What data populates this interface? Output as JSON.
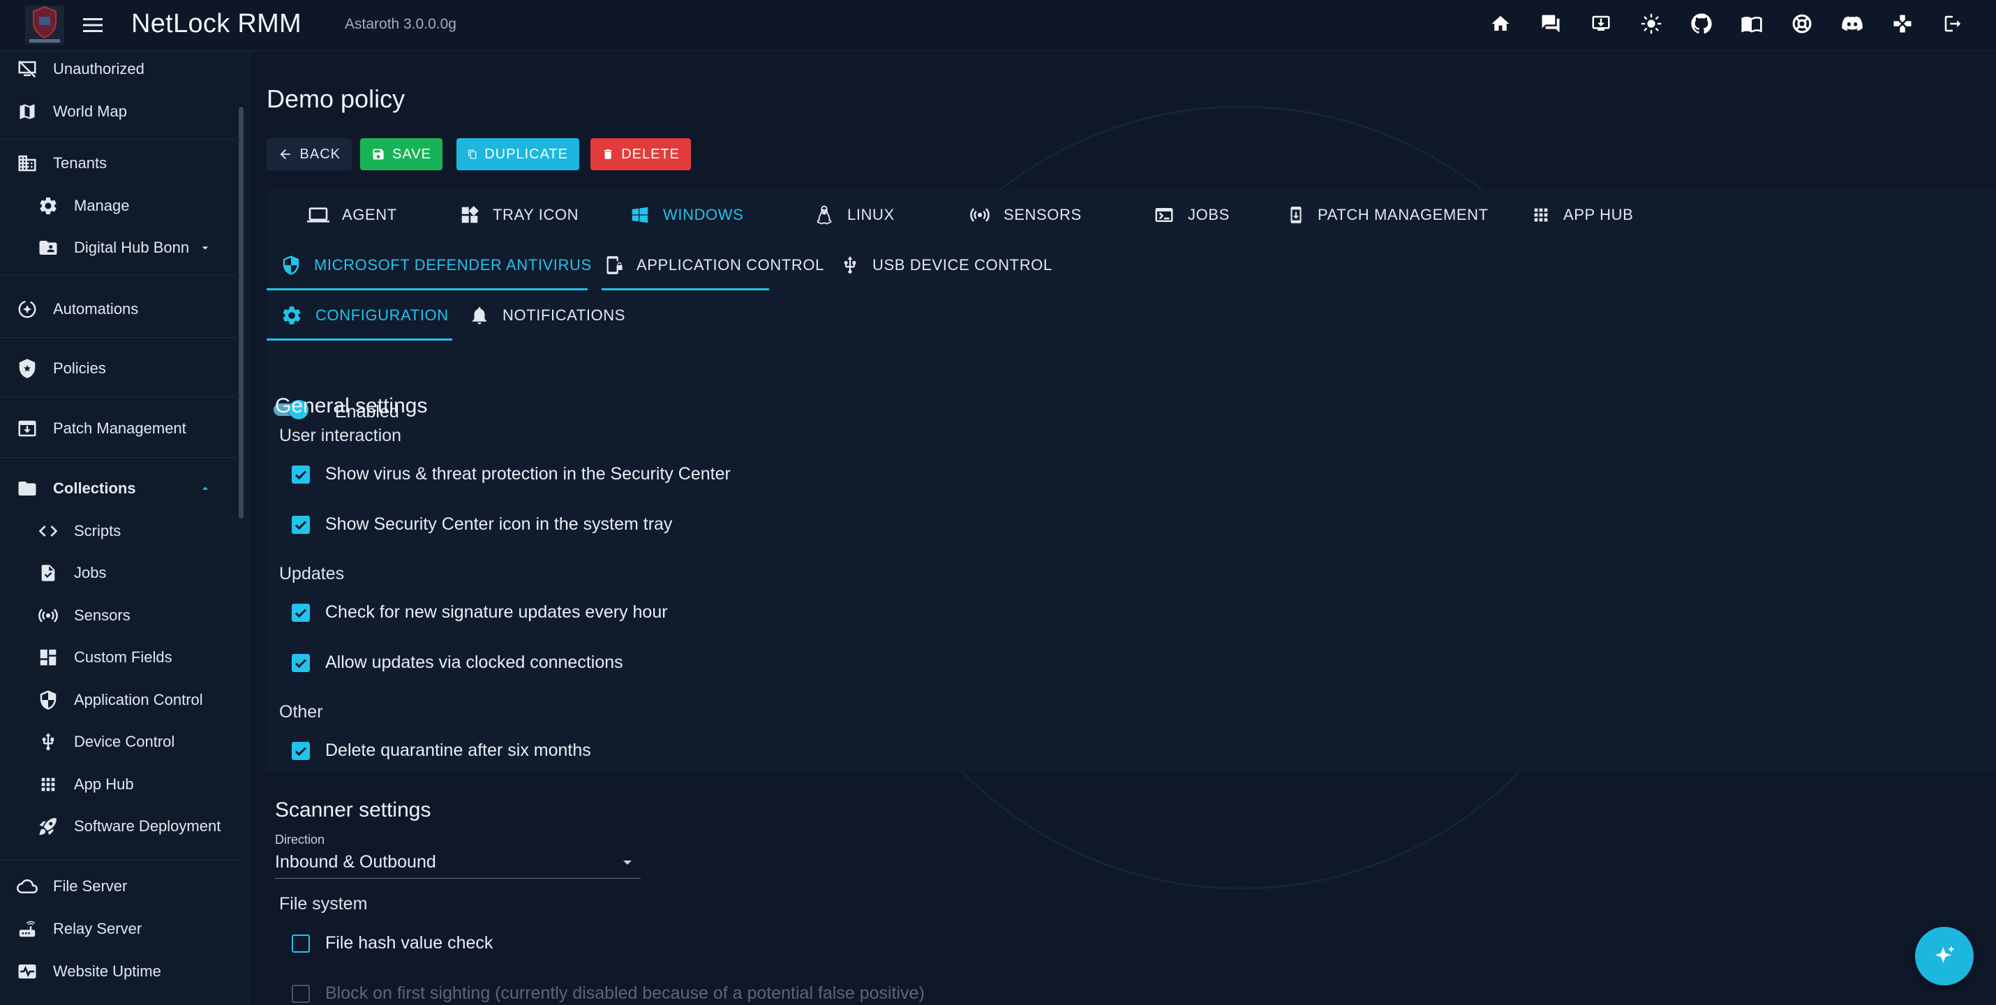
{
  "header": {
    "title": "NetLock RMM",
    "version": "Astaroth 3.0.0.0g",
    "icons": [
      "home-icon",
      "chat-icon",
      "download-icon",
      "theme-icon",
      "github-icon",
      "docs-icon",
      "support-icon",
      "discord-icon",
      "game-icon",
      "logout-icon"
    ]
  },
  "sidebar": {
    "items": [
      {
        "label": "Unauthorized",
        "icon": "monitor-off-icon"
      },
      {
        "label": "World Map",
        "icon": "map-icon"
      },
      {
        "label": "Tenants",
        "icon": "building-icon"
      },
      {
        "label": "Manage",
        "icon": "gear-icon"
      },
      {
        "label": "Digital Hub Bonn",
        "icon": "folder-user-icon"
      },
      {
        "label": "Automations",
        "icon": "automation-icon"
      },
      {
        "label": "Policies",
        "icon": "shield-icon"
      },
      {
        "label": "Patch Management",
        "icon": "patch-icon"
      },
      {
        "label": "Collections",
        "icon": "folder-icon"
      },
      {
        "label": "Scripts",
        "icon": "code-icon"
      },
      {
        "label": "Jobs",
        "icon": "job-icon"
      },
      {
        "label": "Sensors",
        "icon": "sensor-icon"
      },
      {
        "label": "Custom Fields",
        "icon": "dashboard-icon"
      },
      {
        "label": "Application Control",
        "icon": "shield-check-icon"
      },
      {
        "label": "Device Control",
        "icon": "usb-icon"
      },
      {
        "label": "App Hub",
        "icon": "apps-icon"
      },
      {
        "label": "Software Deployment",
        "icon": "rocket-icon"
      },
      {
        "label": "File Server",
        "icon": "cloud-icon"
      },
      {
        "label": "Relay Server",
        "icon": "router-icon"
      },
      {
        "label": "Website Uptime",
        "icon": "pulse-icon"
      }
    ]
  },
  "page": {
    "title": "Demo policy",
    "buttons": {
      "back": "BACK",
      "save": "SAVE",
      "duplicate": "DUPLICATE",
      "delete": "DELETE"
    },
    "tabs_main": [
      "AGENT",
      "TRAY ICON",
      "WINDOWS",
      "LINUX",
      "SENSORS",
      "JOBS",
      "PATCH MANAGEMENT",
      "APP HUB"
    ],
    "tabs_windows": [
      "MICROSOFT DEFENDER ANTIVIRUS",
      "APPLICATION CONTROL",
      "USB DEVICE CONTROL"
    ],
    "tabs_defender": [
      "CONFIGURATION",
      "NOTIFICATIONS"
    ],
    "enabled_label": "Enabled",
    "enabled": true,
    "general": {
      "heading": "General settings",
      "user_interaction": "User interaction",
      "cb_show_virus": "Show virus & threat protection in the Security Center",
      "cb_show_icon": "Show Security Center icon in the system tray",
      "updates": "Updates",
      "cb_check_updates": "Check for new signature updates every hour",
      "cb_allow_clocked": "Allow updates via clocked connections",
      "other": "Other",
      "cb_delete_quarantine": "Delete quarantine after six months"
    },
    "scanner": {
      "heading": "Scanner settings",
      "direction_label": "Direction",
      "direction_value": "Inbound & Outbound",
      "file_system": "File system",
      "cb_file_hash": "File hash value check",
      "cb_block_first": "Block on first sighting (currently disabled because of a potential false positive)"
    }
  },
  "colors": {
    "accent": "#22c3ea",
    "save": "#19b357",
    "delete": "#e33b3b",
    "bg": "#0e1829"
  }
}
